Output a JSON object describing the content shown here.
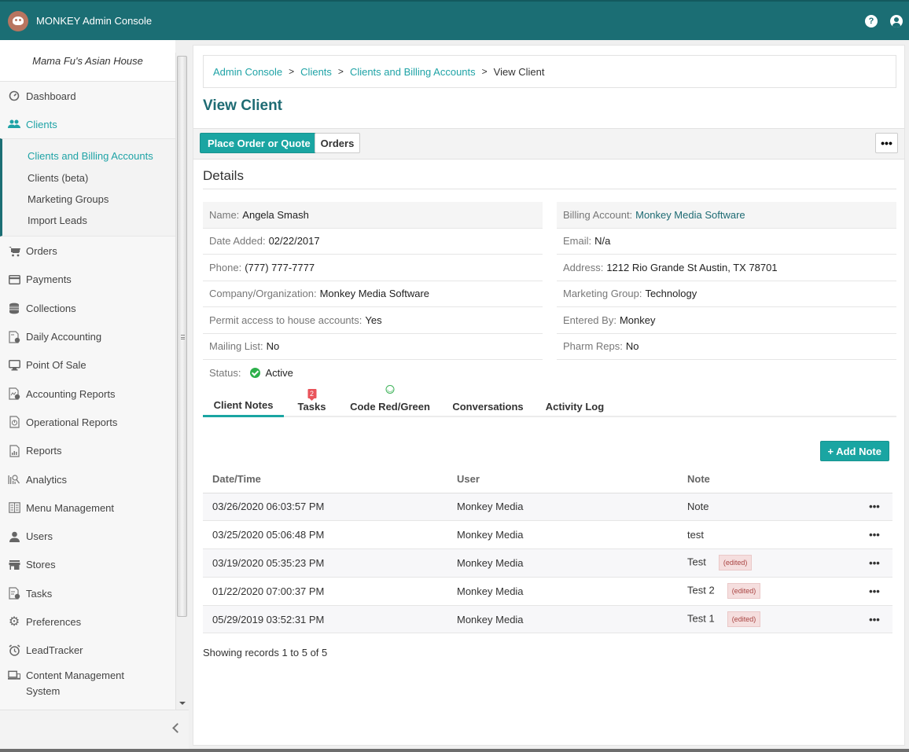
{
  "app": {
    "title": "MONKEY Admin Console",
    "help_icon": "question-circle-icon",
    "user_icon": "user-circle-icon",
    "logo_icon": "monkey-logo-icon"
  },
  "sidebar": {
    "store_name": "Mama Fu's Asian House",
    "items": [
      {
        "label": "Dashboard",
        "icon": "dashboard-gauge-icon"
      },
      {
        "label": "Clients",
        "icon": "users-icon",
        "active": true
      },
      {
        "label": "Orders",
        "icon": "cart-icon"
      },
      {
        "label": "Payments",
        "icon": "credit-card-icon"
      },
      {
        "label": "Collections",
        "icon": "coins-icon"
      },
      {
        "label": "Daily Accounting",
        "icon": "document-dollar-icon"
      },
      {
        "label": "Point Of Sale",
        "icon": "monitor-icon"
      },
      {
        "label": "Accounting Reports",
        "icon": "report-chart-icon"
      },
      {
        "label": "Operational Reports",
        "icon": "report-pie-icon"
      },
      {
        "label": "Reports",
        "icon": "report-bar-icon"
      },
      {
        "label": "Analytics",
        "icon": "analytics-icon"
      },
      {
        "label": "Menu Management",
        "icon": "menu-book-icon"
      },
      {
        "label": "Users",
        "icon": "user-icon"
      },
      {
        "label": "Stores",
        "icon": "store-icon"
      },
      {
        "label": "Tasks",
        "icon": "task-check-icon"
      },
      {
        "label": "Preferences",
        "icon": "gear-icon"
      },
      {
        "label": "LeadTracker",
        "icon": "alarm-clock-icon"
      },
      {
        "label": "Content Management System",
        "icon": "devices-icon"
      }
    ],
    "clients_submenu": [
      {
        "label": "Clients and Billing Accounts",
        "active": true
      },
      {
        "label": "Clients (beta)"
      },
      {
        "label": "Marketing Groups"
      },
      {
        "label": "Import Leads"
      }
    ]
  },
  "breadcrumb": {
    "items": [
      "Admin Console",
      "Clients",
      "Clients and Billing Accounts"
    ],
    "current": "View Client",
    "separator": ">"
  },
  "page": {
    "title": "View Client",
    "actions": {
      "place_order": "Place Order or Quote",
      "orders": "Orders",
      "more": "•••"
    },
    "details_title": "Details"
  },
  "details": {
    "left": [
      {
        "label": "Name:",
        "value": "Angela Smash"
      },
      {
        "label": "Date Added:",
        "value": "02/22/2017"
      },
      {
        "label": "Phone:",
        "value": "(777) 777-7777"
      },
      {
        "label": "Company/Organization:",
        "value": "Monkey Media Software"
      },
      {
        "label": "Permit access to house accounts:",
        "value": "Yes"
      },
      {
        "label": "Mailing List:",
        "value": "No"
      },
      {
        "label": "Status:",
        "value": "Active",
        "status_color": "#2db04b"
      }
    ],
    "right": [
      {
        "label": "Billing Account:",
        "value": "Monkey Media Software"
      },
      {
        "label": "Email:",
        "value": "N/a"
      },
      {
        "label": "Address:",
        "value": "1212 Rio Grande St Austin, TX 78701"
      },
      {
        "label": "Marketing Group:",
        "value": "Technology"
      },
      {
        "label": "Entered By:",
        "value": "Monkey"
      },
      {
        "label": "Pharm Reps:",
        "value": "No"
      }
    ]
  },
  "tabs": [
    {
      "label": "Client Notes",
      "active": true
    },
    {
      "label": "Tasks",
      "badge": "2"
    },
    {
      "label": "Code Red/Green",
      "icon": "smiley-icon"
    },
    {
      "label": "Conversations"
    },
    {
      "label": "Activity Log"
    }
  ],
  "notes": {
    "add_button": "+ Add Note",
    "columns": [
      "Date/Time",
      "User",
      "Note"
    ],
    "rows": [
      {
        "datetime": "03/26/2020 06:03:57 PM",
        "user": "Monkey Media",
        "note": "Note",
        "edited": ""
      },
      {
        "datetime": "03/25/2020 05:06:48 PM",
        "user": "Monkey Media",
        "note": "test",
        "edited": ""
      },
      {
        "datetime": "03/19/2020 05:35:23 PM",
        "user": "Monkey Media",
        "note": "Test",
        "edited": "(edited)"
      },
      {
        "datetime": "01/22/2020 07:00:37 PM",
        "user": "Monkey Media",
        "note": "Test 2",
        "edited": "(edited)"
      },
      {
        "datetime": "05/29/2019 03:52:31 PM",
        "user": "Monkey Media",
        "note": "Test 1",
        "edited": "(edited)"
      }
    ],
    "row_menu": "•••",
    "footer": "Showing records 1 to 5 of 5"
  },
  "colors": {
    "header": "#1b6e74",
    "accent": "#1aa5a2",
    "title": "#1e6b73",
    "badge": "#e9535a"
  }
}
